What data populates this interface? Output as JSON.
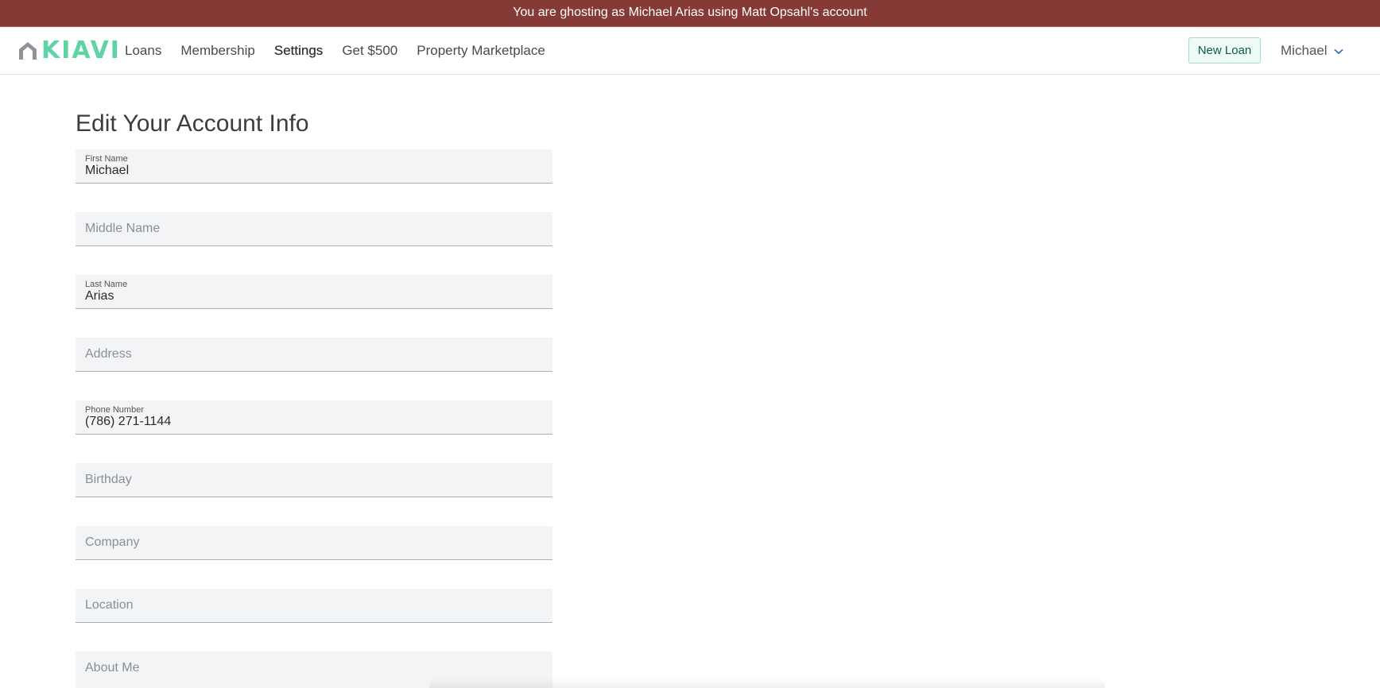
{
  "banner": {
    "text": "You are ghosting as Michael Arias using Matt Opsahl's account"
  },
  "nav": {
    "logo_text": "KIAVI",
    "links": [
      {
        "label": "Loans"
      },
      {
        "label": "Membership"
      },
      {
        "label": "Settings",
        "active": true
      },
      {
        "label": "Get $500"
      },
      {
        "label": "Property Marketplace"
      }
    ],
    "new_loan_label": "New Loan",
    "user_name": "Michael",
    "brand_color": "#5ed3a3",
    "banner_color": "#853a35"
  },
  "form": {
    "title": "Edit Your Account Info",
    "fields": [
      {
        "label": "First Name",
        "value": "Michael"
      },
      {
        "label": "Middle Name",
        "value": ""
      },
      {
        "label": "Last Name",
        "value": "Arias"
      },
      {
        "label": "Address",
        "value": ""
      },
      {
        "label": "Phone Number",
        "value": "(786) 271-1144"
      },
      {
        "label": "Birthday",
        "value": ""
      },
      {
        "label": "Company",
        "value": ""
      },
      {
        "label": "Location",
        "value": ""
      },
      {
        "label": "About Me",
        "value": ""
      }
    ]
  }
}
